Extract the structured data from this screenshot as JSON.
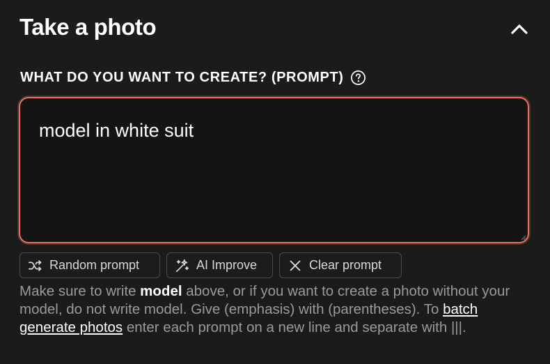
{
  "header": {
    "title": "Take a photo",
    "collapse_icon": "chevron-up-icon"
  },
  "prompt": {
    "label": "WHAT DO YOU WANT TO CREATE? (PROMPT)",
    "help_icon": "question-circle-icon",
    "value": "model in white suit",
    "accent_color": "#e7705f"
  },
  "actions": {
    "random_label": "Random prompt",
    "random_icon": "shuffle-icon",
    "improve_label": "AI Improve",
    "improve_icon": "sparkles-icon",
    "clear_label": "Clear prompt",
    "clear_icon": "x-icon"
  },
  "help": {
    "part1": "Make sure to write ",
    "bold_word": "model",
    "part2": " above, or if you want to create a photo without your model, do not write model. Give (emphasis) with (parentheses). To ",
    "link_text": "batch generate photos",
    "part3": " enter each prompt on a new line and separate with |||."
  }
}
